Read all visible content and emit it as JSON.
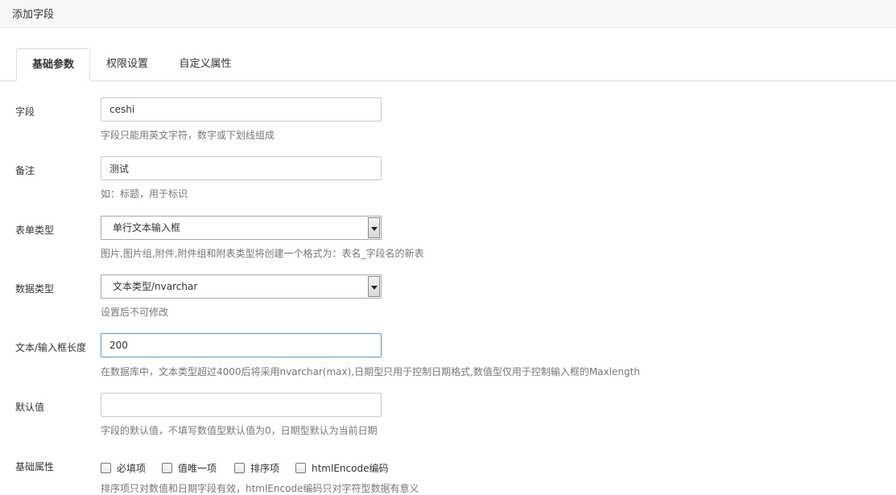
{
  "page": {
    "title": "添加字段"
  },
  "tabs": [
    {
      "label": "基础参数",
      "active": true
    },
    {
      "label": "权限设置",
      "active": false
    },
    {
      "label": "自定义属性",
      "active": false
    }
  ],
  "form": {
    "field": {
      "label": "字段",
      "value": "ceshi",
      "hint": "字段只能用英文字符，数字或下划线组成"
    },
    "remark": {
      "label": "备注",
      "value": "测试",
      "hint": "如：标题，用于标识"
    },
    "form_type": {
      "label": "表单类型",
      "selected": "单行文本输入框",
      "hint": "图片,图片组,附件,附件组和附表类型将创建一个格式为：表名_字段名的新表"
    },
    "data_type": {
      "label": "数据类型",
      "selected": "文本类型/nvarchar",
      "hint": "设置后不可修改"
    },
    "length": {
      "label": "文本/输入框长度",
      "value": "200",
      "hint": "在数据库中，文本类型超过4000后将采用nvarchar(max),日期型只用于控制日期格式,数值型仅用于控制输入框的Maxlength"
    },
    "default": {
      "label": "默认值",
      "value": "",
      "hint": "字段的默认值，不填写数值型默认值为0，日期型默认为当前日期"
    },
    "basic": {
      "label": "基础属性",
      "options": [
        {
          "label": "必填项",
          "checked": false
        },
        {
          "label": "值唯一项",
          "checked": false
        },
        {
          "label": "排序项",
          "checked": false
        },
        {
          "label": "htmlEncode编码",
          "checked": false
        }
      ],
      "hint": "排序项只对数值和日期字段有效，htmlEncode编码只对字符型数据有意义"
    }
  }
}
